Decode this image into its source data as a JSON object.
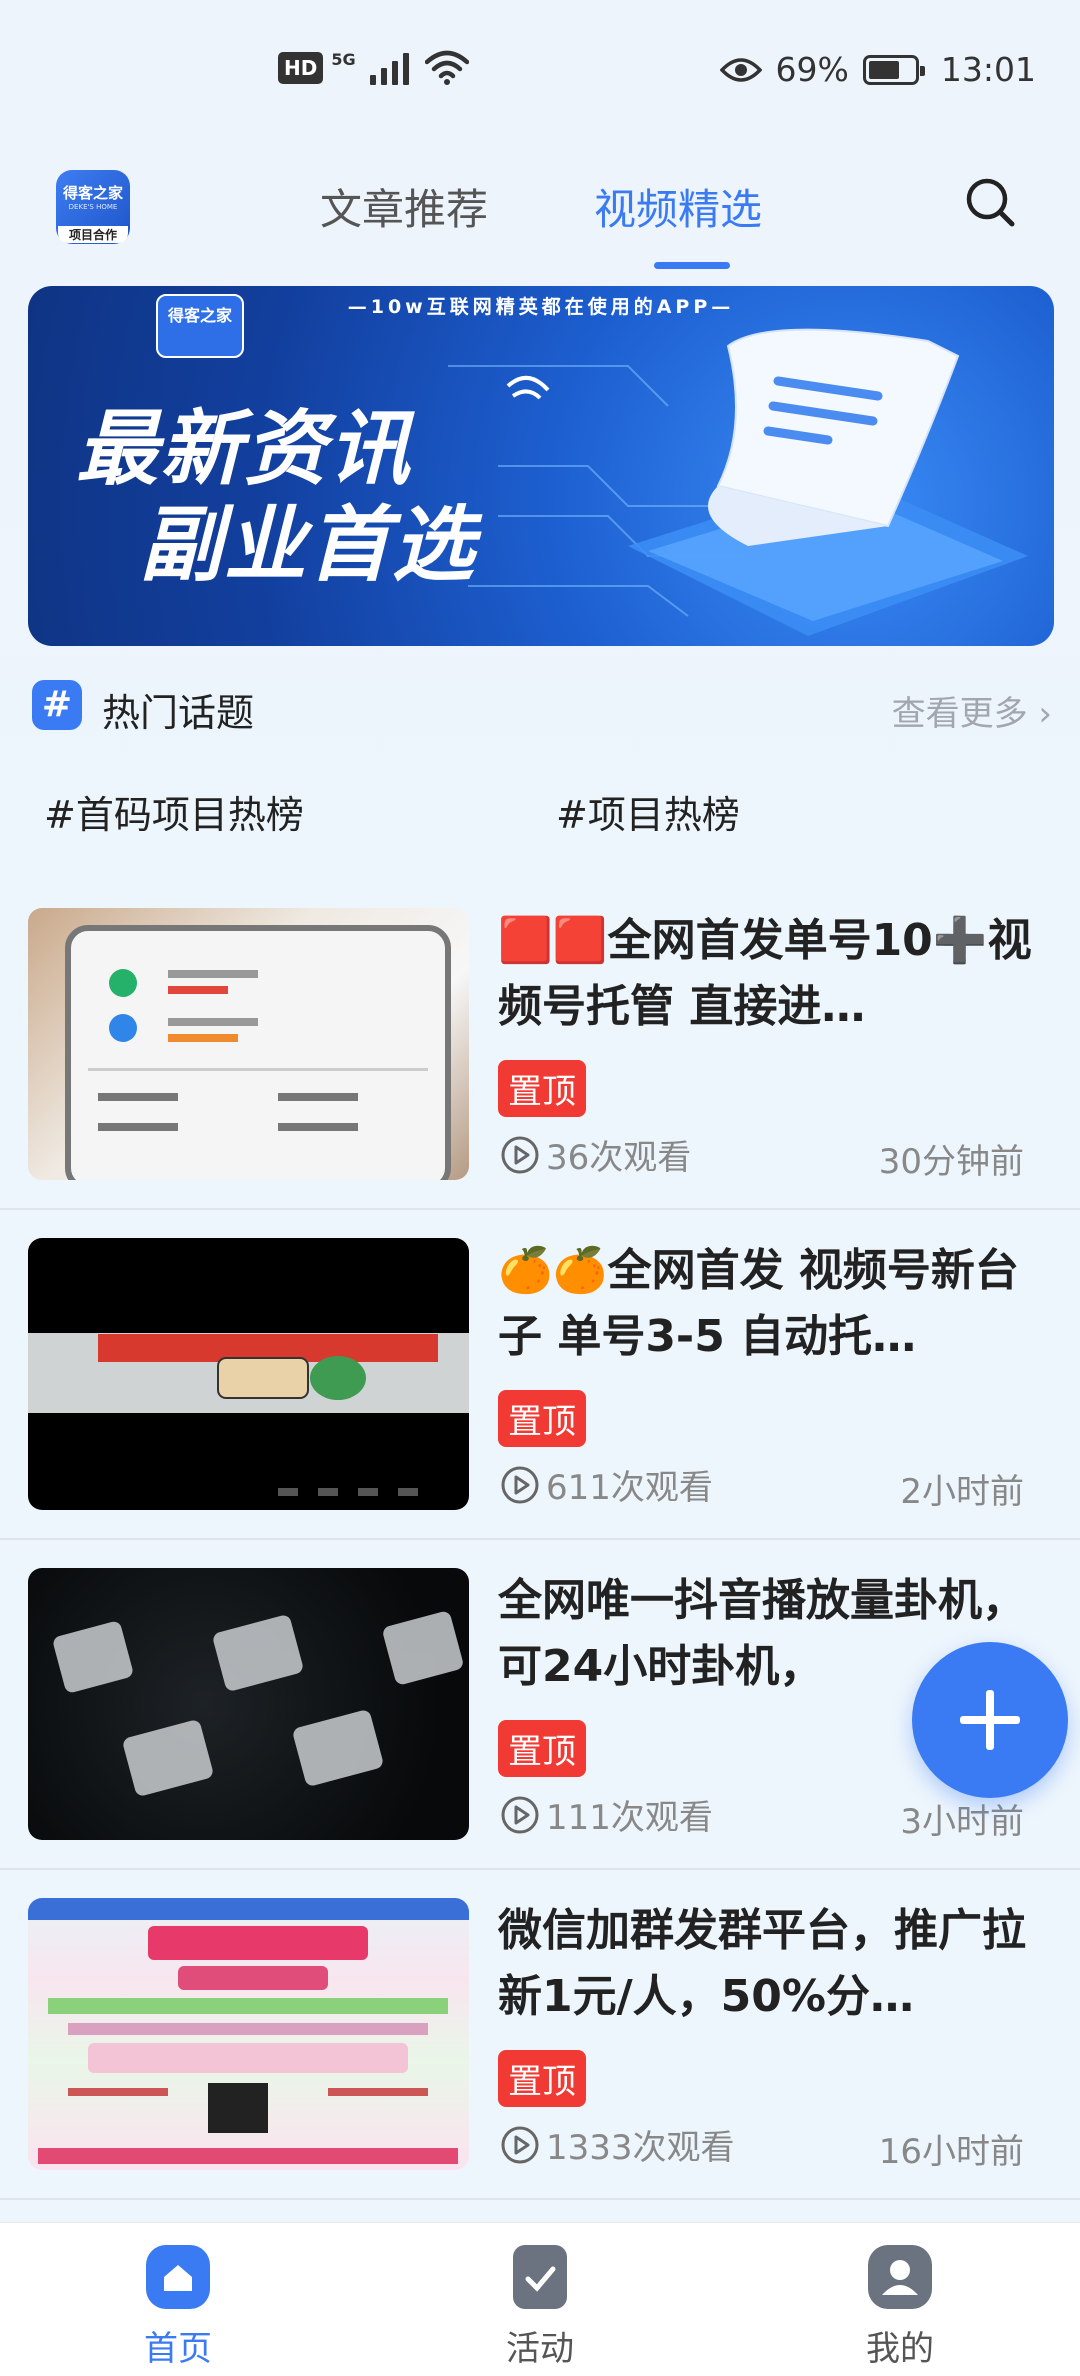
{
  "status_bar": {
    "hd": "HD",
    "network": "5G",
    "battery_percent": "69%",
    "battery_level": 0.69,
    "time": "13:01",
    "icons": [
      "signal-icon",
      "wifi-icon",
      "eye-icon",
      "battery-icon"
    ]
  },
  "header": {
    "logo_text": "得客之家",
    "logo_sub": "项目合作",
    "tabs": [
      {
        "label": "文章推荐",
        "active": false
      },
      {
        "label": "视频精选",
        "active": true
      }
    ]
  },
  "banner": {
    "tagline": "—10w互联网精英都在使用的APP—",
    "logo_text": "得客之家",
    "line1": "最新资讯",
    "line2": "副业首选"
  },
  "hot_topics": {
    "title": "热门话题",
    "see_more": "查看更多 ›",
    "topics": [
      "#首码项目热榜",
      "#项目热榜"
    ]
  },
  "videos": [
    {
      "title": "🟥🟥全网首发单号10➕视频号托管 直接进…",
      "pin": "置顶",
      "views": "36次观看",
      "time": "30分钟前"
    },
    {
      "title": "🍊🍊全网首发 视频号新台子 单号3-5 自动托…",
      "pin": "置顶",
      "views": "611次观看",
      "time": "2小时前"
    },
    {
      "title": "全网唯一抖音播放量卦机，可24小时卦机，",
      "pin": "置顶",
      "views": "111次观看",
      "time": "3小时前"
    },
    {
      "title": "微信加群发群平台，推广拉新1元/人，50%分…",
      "pin": "置顶",
      "views": "1333次观看",
      "time": "16小时前"
    }
  ],
  "bottom_nav": [
    {
      "label": "首页",
      "active": true
    },
    {
      "label": "活动",
      "active": false
    },
    {
      "label": "我的",
      "active": false
    }
  ],
  "colors": {
    "accent": "#3a7bf3",
    "pin": "#f13a33"
  }
}
